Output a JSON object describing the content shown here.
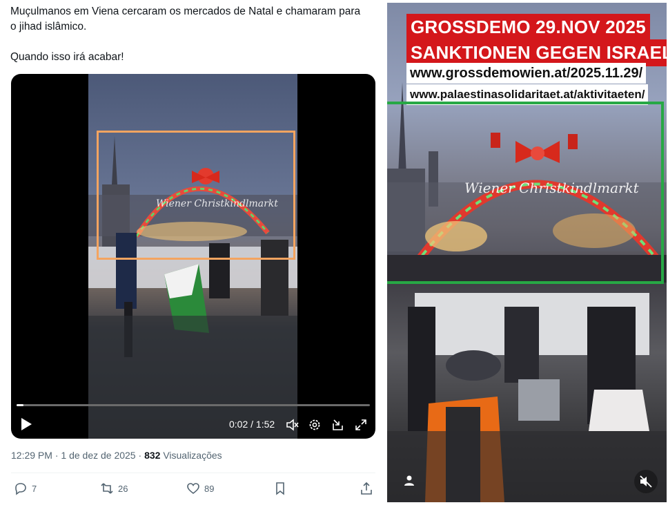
{
  "tweet": {
    "line1": "Muçulmanos em Viena cercaram os mercados de Natal e chamaram para o jihad islâmico.",
    "line2": "Quando isso irá acabar!"
  },
  "video": {
    "sign_text": "Wiener Christkindlmarkt",
    "time": "0:02 / 1:52",
    "progress": 0.02,
    "highlight_color": "#f4a460"
  },
  "meta": {
    "time": "12:29 PM",
    "date": "1 de dez de 2025",
    "views": "832",
    "views_label": "Visualizações"
  },
  "actions": {
    "replies": "7",
    "reposts": "26",
    "likes": "89"
  },
  "story": {
    "banner_line1": "GROSSDEMO 29.NOV 2025",
    "banner_line2": "SANKTIONEN GEGEN ISRAEL",
    "url1": "www.grossdemowien.at/2025.11.29/",
    "url2": "www.palaestinasolidaritaet.at/aktivitaeten/",
    "sign_text": "Wiener Christkindlmarkt",
    "highlight_color": "#27a845",
    "banner_color": "#d4171b"
  }
}
